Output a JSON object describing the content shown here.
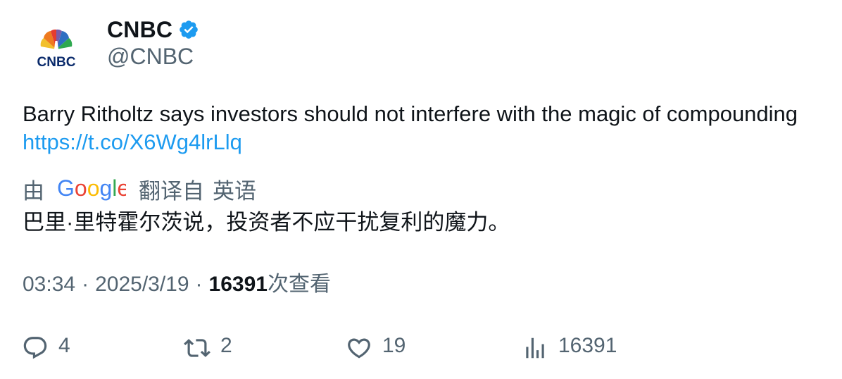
{
  "author": {
    "display_name": "CNBC",
    "handle": "@CNBC",
    "verified": true,
    "avatar_text": "CNBC",
    "avatar_icon": "cnbc-peacock-logo"
  },
  "tweet": {
    "text": "Barry Ritholtz says investors should not interfere with the magic of compounding ",
    "link": "https://t.co/X6Wg4lrLlq"
  },
  "translation": {
    "by_label": "由",
    "provider": "Google",
    "from_label": "翻译自",
    "source_language": "英语",
    "text": "巴里·里特霍尔茨说，投资者不应干扰复利的魔力。"
  },
  "meta": {
    "time": "03:34",
    "separator": "·",
    "date": "2025/3/19",
    "views": "16391",
    "views_label": "次查看"
  },
  "actions": {
    "replies": "4",
    "retweets": "2",
    "likes": "19",
    "views": "16391"
  },
  "colors": {
    "text_primary": "#0f1419",
    "text_secondary": "#536471",
    "link": "#1d9bf0",
    "verified": "#1d9bf0"
  }
}
